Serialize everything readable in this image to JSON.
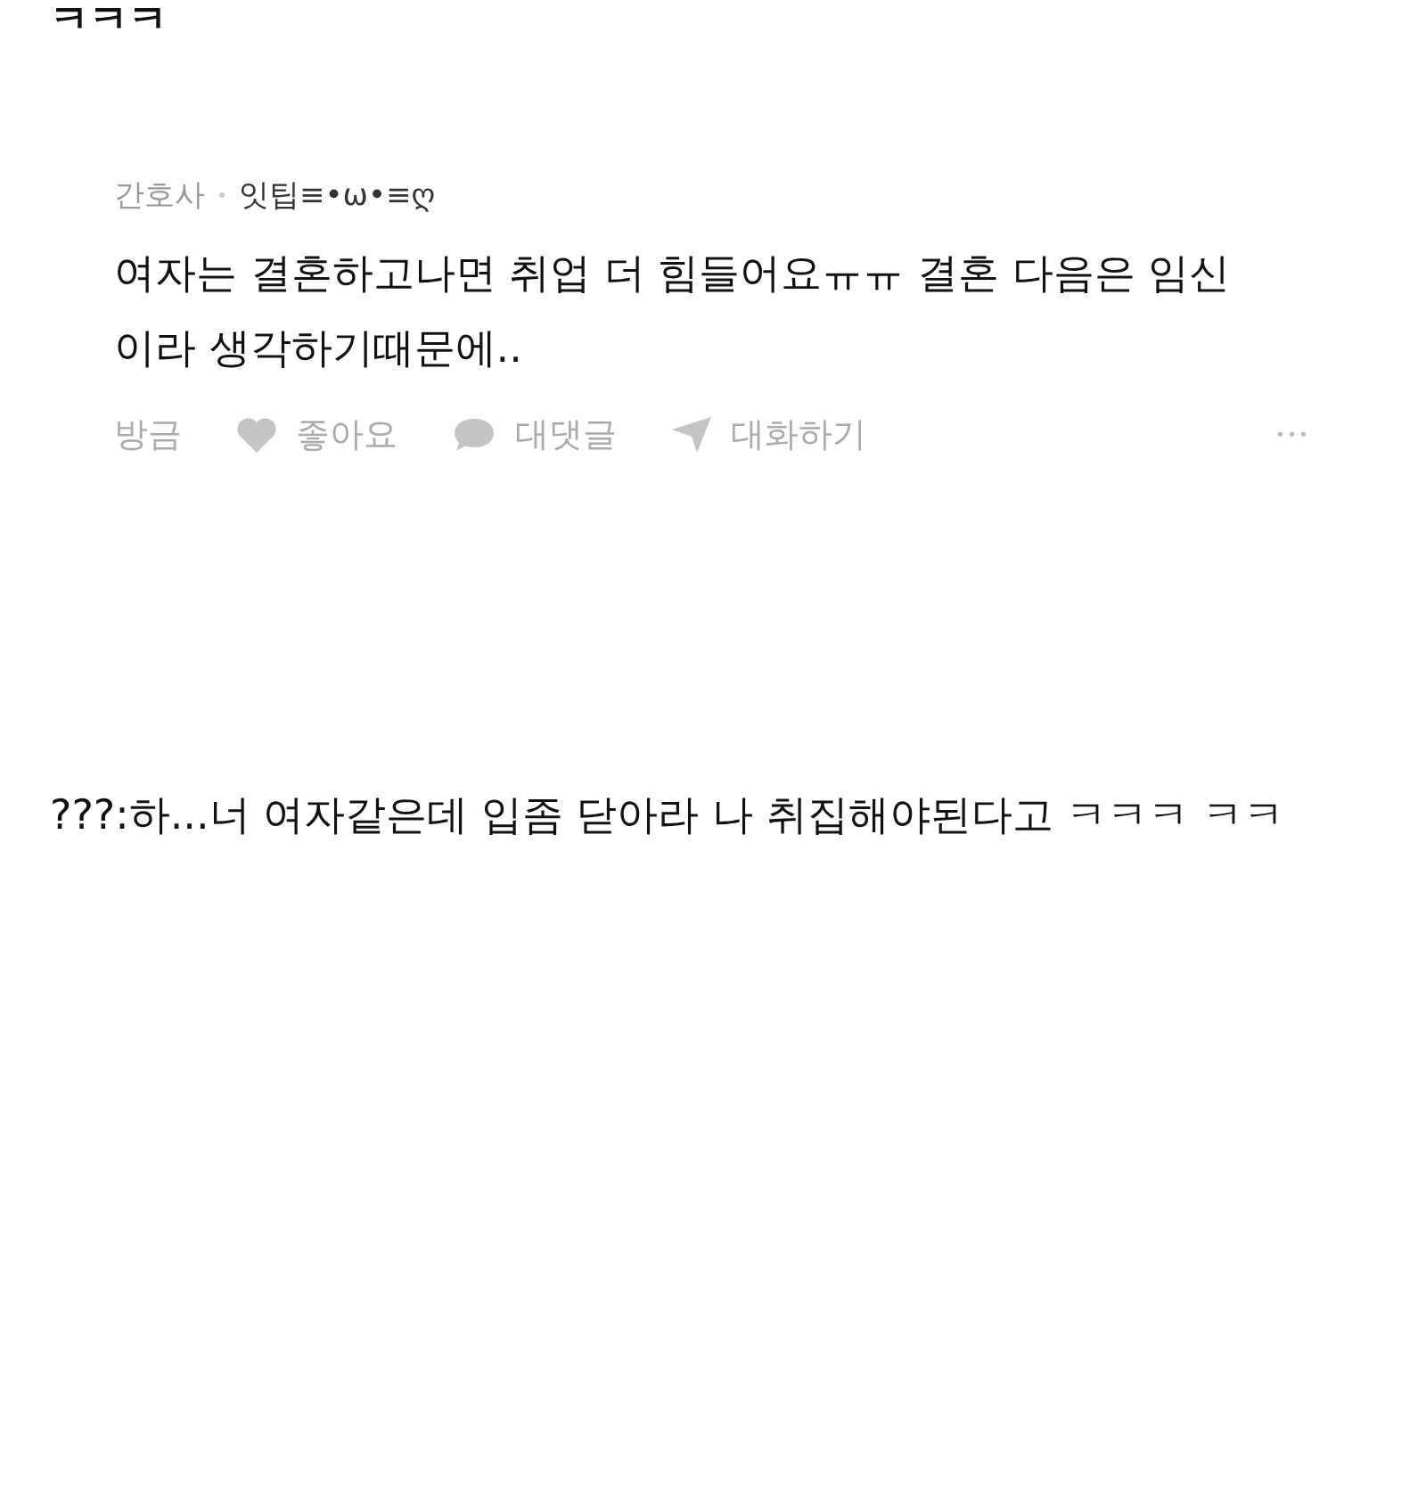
{
  "top_text": "ㅋㅋㅋ",
  "comment": {
    "author_tag": "간호사",
    "author": "잇팁≡•ω•≡ღ",
    "body": "여자는 결혼하고나면 취업 더 힘들어요ㅠㅠ 결혼 다음은 임신이라 생각하기때문에..",
    "time": "방금",
    "actions": [
      {
        "kind": "like",
        "label": "좋아요"
      },
      {
        "kind": "reply",
        "label": "대댓글"
      },
      {
        "kind": "chat",
        "label": "대화하기"
      }
    ],
    "more": "•••"
  },
  "reply_text": "???:하...너 여자같은데 입좀 닫아라 나 취집해야된다고 ㅋㅋㅋ ㅋㅋ"
}
